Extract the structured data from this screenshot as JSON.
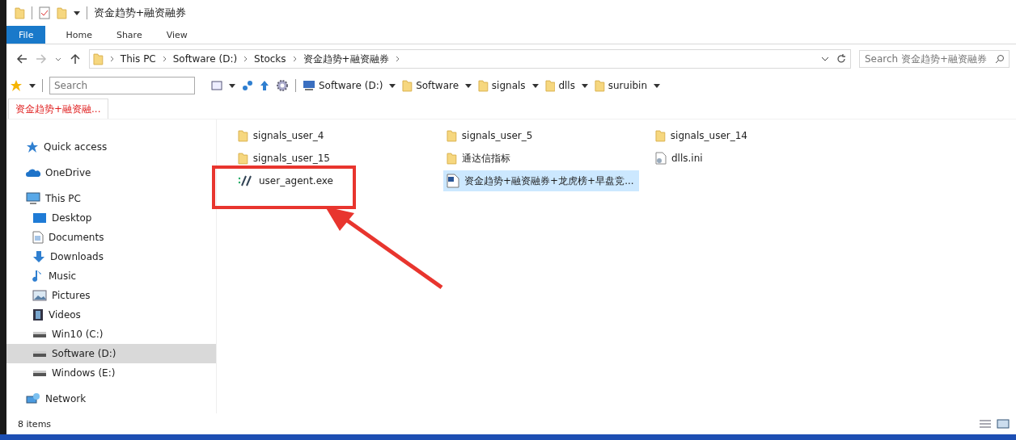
{
  "window": {
    "title": "资金趋势+融资融券"
  },
  "ribbon_tabs": [
    {
      "label": "File",
      "selected": true
    },
    {
      "label": "Home",
      "selected": false
    },
    {
      "label": "Share",
      "selected": false
    },
    {
      "label": "View",
      "selected": false
    }
  ],
  "address_bar": {
    "crumbs": [
      "This PC",
      "Software (D:)",
      "Stocks",
      "资金趋势+融资融券"
    ]
  },
  "search": {
    "placeholder": "Search 资金趋势+融资融券"
  },
  "toolbar": {
    "search_placeholder": "Search",
    "locations": [
      {
        "label": "Software (D:)",
        "kind": "drive"
      },
      {
        "label": "Software",
        "kind": "folder"
      },
      {
        "label": "signals",
        "kind": "folder"
      },
      {
        "label": "dlls",
        "kind": "folder"
      },
      {
        "label": "suruibin",
        "kind": "folder"
      }
    ]
  },
  "folder_tabs": [
    {
      "label": "资金趋势+融资融...",
      "selected": true
    }
  ],
  "sidebar": {
    "items": [
      {
        "label": "Quick access",
        "kind": "star",
        "selected": false
      },
      {
        "label": "OneDrive",
        "kind": "cloud",
        "selected": false
      },
      {
        "label": "This PC",
        "kind": "pc",
        "selected": false,
        "children": [
          {
            "label": "Desktop",
            "kind": "desktop",
            "selected": false
          },
          {
            "label": "Documents",
            "kind": "documents",
            "selected": false
          },
          {
            "label": "Downloads",
            "kind": "downloads",
            "selected": false
          },
          {
            "label": "Music",
            "kind": "music",
            "selected": false
          },
          {
            "label": "Pictures",
            "kind": "pictures",
            "selected": false
          },
          {
            "label": "Videos",
            "kind": "videos",
            "selected": false
          },
          {
            "label": "Win10 (C:)",
            "kind": "drive",
            "selected": false
          },
          {
            "label": "Software (D:)",
            "kind": "drive",
            "selected": true
          },
          {
            "label": "Windows (E:)",
            "kind": "drive",
            "selected": false
          }
        ]
      },
      {
        "label": "Network",
        "kind": "network",
        "selected": false
      }
    ]
  },
  "files": [
    {
      "name": "signals_user_4",
      "kind": "folder",
      "selected": false,
      "highlighted": false
    },
    {
      "name": "signals_user_5",
      "kind": "folder",
      "selected": false,
      "highlighted": false
    },
    {
      "name": "signals_user_14",
      "kind": "folder",
      "selected": false,
      "highlighted": false
    },
    {
      "name": "signals_user_15",
      "kind": "folder",
      "selected": false,
      "highlighted": false
    },
    {
      "name": "通达信指标",
      "kind": "folder",
      "selected": false,
      "highlighted": false
    },
    {
      "name": "dlls.ini",
      "kind": "settings",
      "selected": false,
      "highlighted": false
    },
    {
      "name": "user_agent.exe",
      "kind": "exe",
      "selected": false,
      "highlighted": true
    },
    {
      "name": "资金趋势+融资融券+龙虎榜+早盘竞...",
      "kind": "document",
      "selected": true,
      "highlighted": false
    }
  ],
  "status_bar": {
    "count": "8 items"
  }
}
